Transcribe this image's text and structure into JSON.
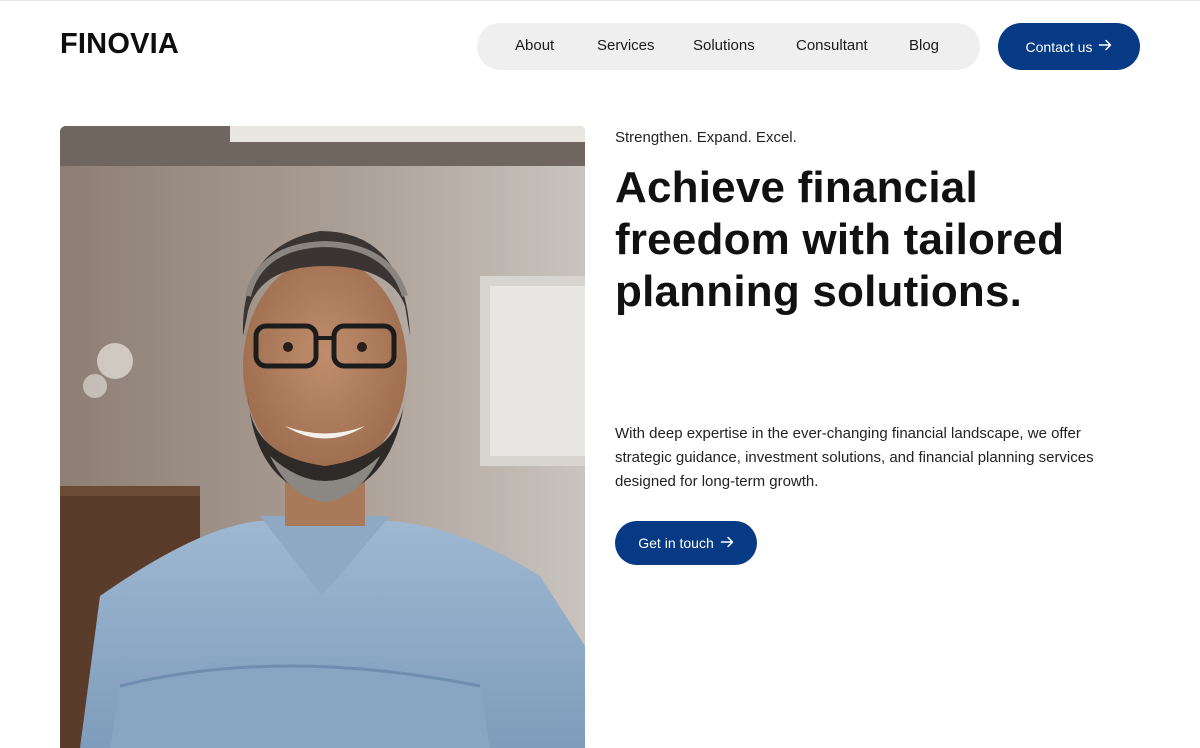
{
  "brand": {
    "logo_text": "FINOVIA"
  },
  "nav": {
    "items": [
      {
        "label": "About"
      },
      {
        "label": "Services"
      },
      {
        "label": "Solutions"
      },
      {
        "label": "Consultant"
      },
      {
        "label": "Blog"
      }
    ],
    "contact_label": "Contact us",
    "contact_icon": "arrow-right-icon"
  },
  "hero": {
    "eyebrow": "Strengthen. Expand. Excel.",
    "headline": "Achieve financial freedom with tailored planning solutions.",
    "description": "With deep expertise in the ever-changing financial landscape, we offer strategic guidance, investment solutions, and financial planning services designed for long-term growth.",
    "cta_label": "Get in touch",
    "cta_icon": "arrow-right-icon",
    "photo_subject": "smiling bearded man in light blue shirt with arms crossed"
  },
  "colors": {
    "primary": "#063a84",
    "nav_background": "#efefef",
    "text": "#111111"
  }
}
